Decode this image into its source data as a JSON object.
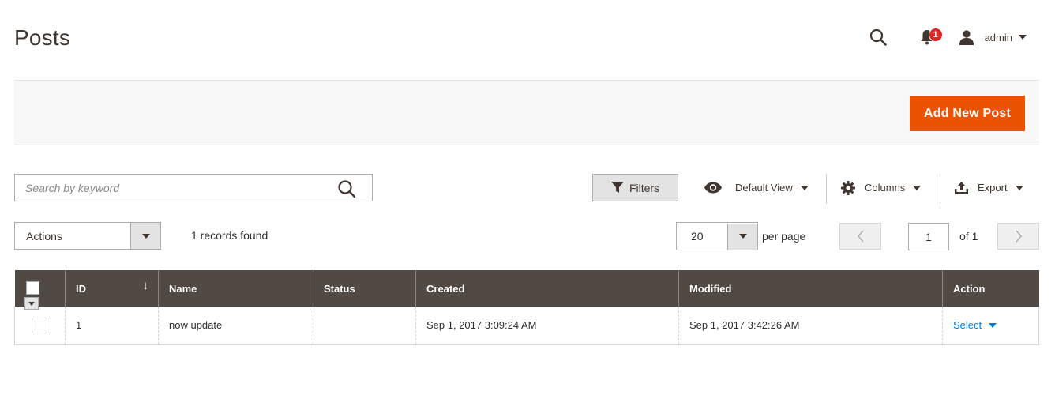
{
  "page": {
    "title": "Posts"
  },
  "header": {
    "notifications_count": "1",
    "user_name": "admin"
  },
  "page_actions": {
    "add_new_label": "Add New Post"
  },
  "toolbar": {
    "search_placeholder": "Search by keyword",
    "filters_label": "Filters",
    "view_label": "Default View",
    "columns_label": "Columns",
    "export_label": "Export",
    "actions_label": "Actions",
    "records_found": "1 records found",
    "per_page_value": "20",
    "per_page_label": "per page",
    "current_page": "1",
    "total_pages_label": "of 1"
  },
  "grid": {
    "columns": [
      "ID",
      "Name",
      "Status",
      "Created",
      "Modified",
      "Action"
    ],
    "rows": [
      {
        "id": "1",
        "name": "now update",
        "status": "",
        "created": "Sep 1, 2017 3:09:24 AM",
        "modified": "Sep 1, 2017 3:42:26 AM",
        "action": "Select"
      }
    ]
  },
  "colors": {
    "primary_button": "#eb5202",
    "grid_header": "#514943",
    "link": "#007bdb",
    "badge": "#e22626"
  },
  "icons": {
    "search": "search-icon",
    "notifications": "bell-icon",
    "user": "user-icon",
    "filter": "filter-icon",
    "view": "eye-icon",
    "columns": "gear-icon",
    "export": "export-icon"
  }
}
